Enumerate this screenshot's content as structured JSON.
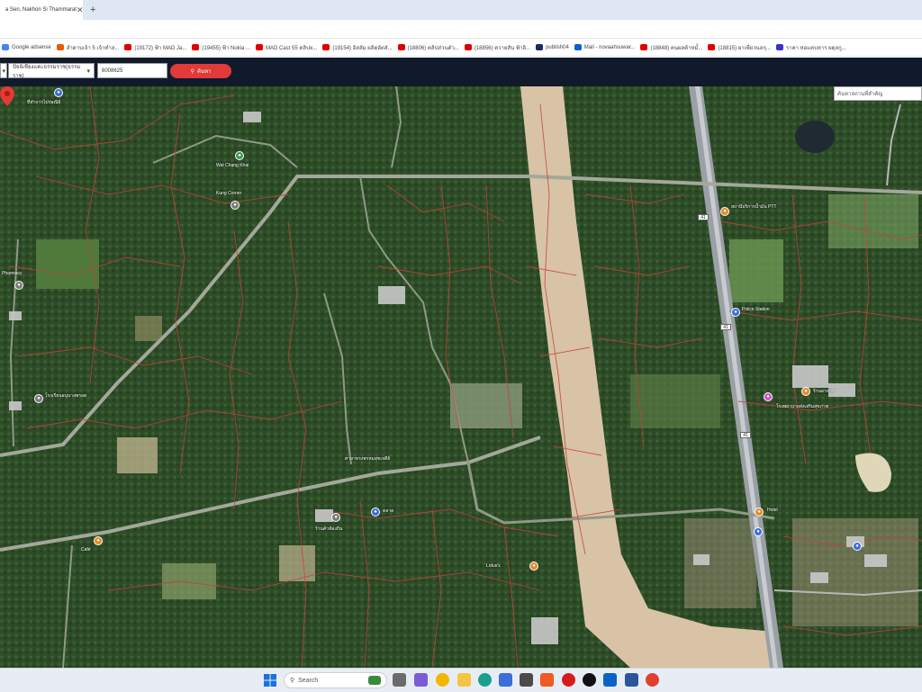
{
  "browser": {
    "tab_title": "a Sen, Nakhon Si Thammarat",
    "tab_close": "✕",
    "new_tab": "+"
  },
  "bookmarks": [
    {
      "label": "Google adsense",
      "color": "#4285f4"
    },
    {
      "label": "ลำดาบเจ้า 5 เจ้าทำล...",
      "color": "#e65c00"
    },
    {
      "label": "(19172) ฟ้า MAD Ja...",
      "color": "#e00000"
    },
    {
      "label": "(19455) ฟ้า Nokia ...",
      "color": "#e00000"
    },
    {
      "label": "MAD Cast 55 คลิปย...",
      "color": "#e00000"
    },
    {
      "label": "(19154) อิสลัม ผลิตอัตลั...",
      "color": "#e00000"
    },
    {
      "label": "(18806) คลิปส่วนตัว...",
      "color": "#e00000"
    },
    {
      "label": "(18856) ควายสัน ฟ้าอิ...",
      "color": "#e00000"
    },
    {
      "label": "publish04",
      "color": "#1a2a66"
    },
    {
      "label": "Mail - novaahsuwar...",
      "color": "#0a64c8"
    },
    {
      "label": "(18848) คนผลค้าหมั้...",
      "color": "#e00000"
    },
    {
      "label": "(18815) ผาเพี่ยวนลกุ...",
      "color": "#e00000"
    },
    {
      "label": "ราคา ห่อแคบหาร ผดุลกู...",
      "color": "#3b2fd0"
    }
  ],
  "toolbar": {
    "province_select": "",
    "district_select": "ปัจจ์เชียงแคะธรรมราช(ธรรมราช)",
    "parcel_input": "6008625",
    "search_button": "ค้นหา"
  },
  "map": {
    "search_placeholder": "ค้นหาสถานที่สำคัญ",
    "pois": [
      {
        "label": "Wat Chang Khai"
      },
      {
        "label": "Kung Corner"
      },
      {
        "label": "ที่ทำการไปรษณีย์"
      },
      {
        "label": "Pharmacy"
      },
      {
        "label": "โรงเรียนอนุบาลพรอด"
      },
      {
        "label": "ร้านค้าท้องถิ่น"
      },
      {
        "label": "สถานีบริการน้ำมัน PTT"
      },
      {
        "label": "Police Station"
      },
      {
        "label": "โรงพยาบาลส่งเสริมสุขภาพ"
      },
      {
        "label": "ร้านอาหาร"
      },
      {
        "label": "ตลาด"
      },
      {
        "label": "Lotus's"
      },
      {
        "label": "Café"
      },
      {
        "label": "Hotel"
      }
    ],
    "pin_label": "ศาลาทรงพรหมสุขเจดีย์",
    "road_shields": [
      "41",
      "41",
      "41"
    ]
  },
  "taskbar": {
    "search_placeholder": "Search"
  }
}
